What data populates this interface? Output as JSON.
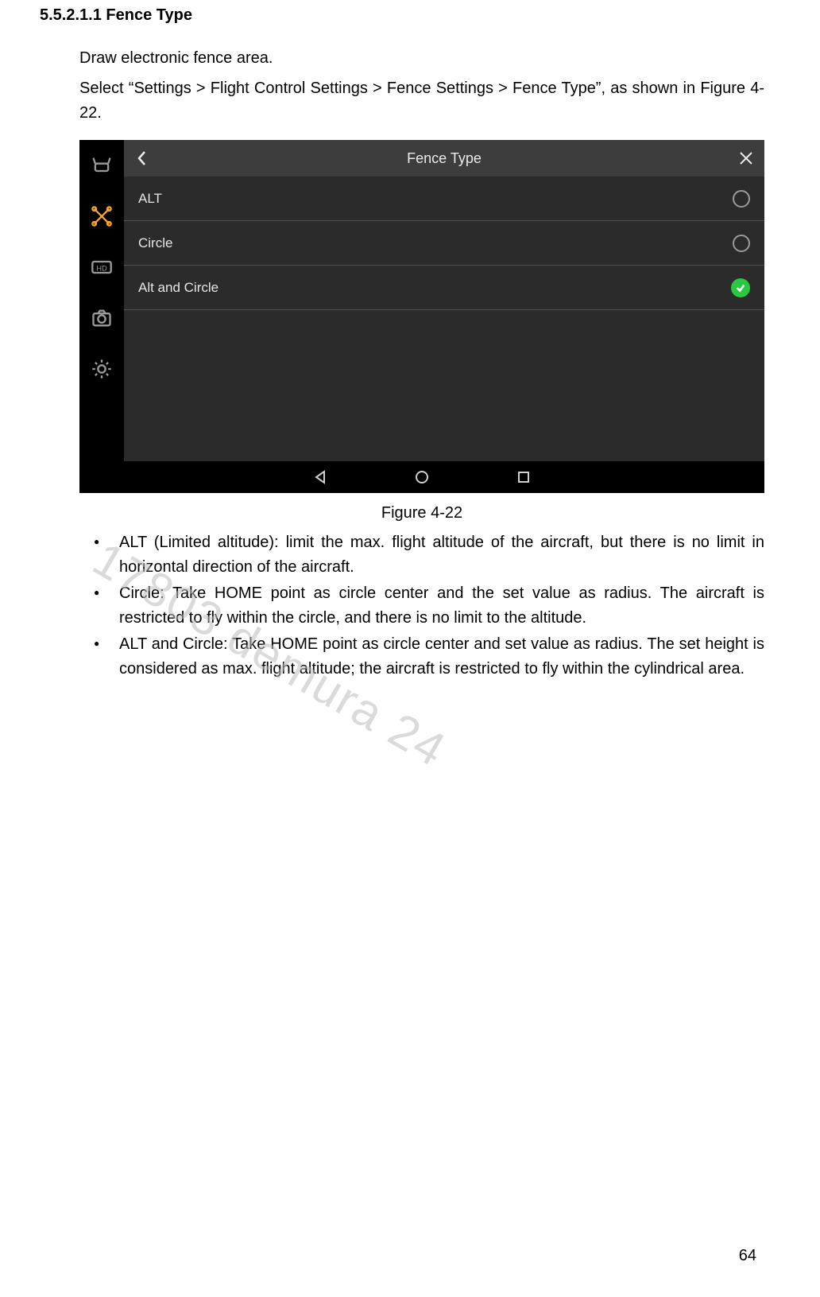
{
  "heading": "5.5.2.1.1 Fence Type",
  "intro": "Draw electronic fence area.",
  "navline": "Select “Settings > Flight Control Settings > Fence Settings > Fence Type”, as shown in Figure 4-22.",
  "figure": {
    "title": "Fence Type",
    "rows": [
      {
        "label": "ALT",
        "selected": false
      },
      {
        "label": "Circle",
        "selected": false
      },
      {
        "label": "Alt and Circle",
        "selected": true
      }
    ],
    "caption": "Figure 4-22"
  },
  "bullets": [
    "ALT (Limited altitude): limit the max. flight altitude of the aircraft, but there is no limit in horizontal direction of the aircraft.",
    "Circle: Take HOME point as circle center and the set value as radius. The aircraft is restricted to fly within the circle, and there is no limit to the altitude.",
    "ALT and Circle: Take HOME point as circle center and set value as radius. The set height is considered as max. flight altitude; the aircraft is restricted to fly within the cylindrical area."
  ],
  "watermark": "17803 demura 24",
  "pageNumber": "64"
}
